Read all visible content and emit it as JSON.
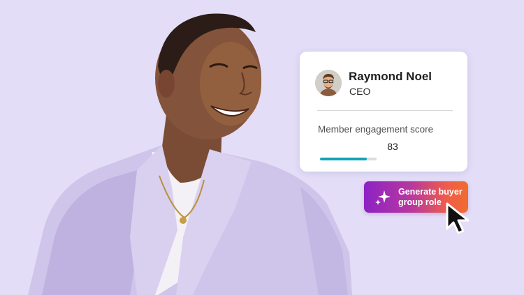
{
  "profile": {
    "name": "Raymond Noel",
    "title": "CEO",
    "metric_label": "Member engagement score",
    "metric_value": "83",
    "metric_fraction": 0.83
  },
  "action": {
    "label": "Generate buyer group role",
    "icon": "sparkle-icon"
  },
  "colors": {
    "background": "#e3ddf7",
    "progress": "#12a5b5",
    "button_gradient_start": "#8d22c4",
    "button_gradient_end": "#f26b2e"
  }
}
